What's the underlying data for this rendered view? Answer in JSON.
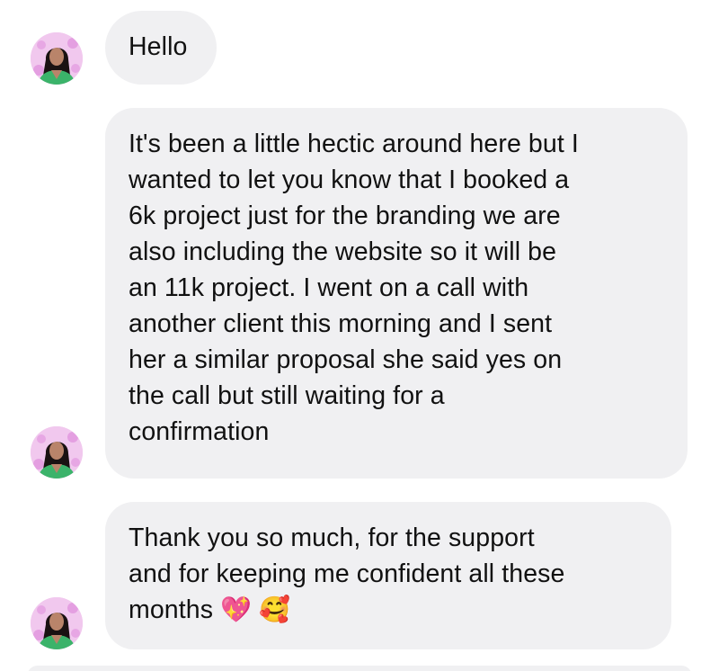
{
  "colors": {
    "bubble_background": "#f0f0f2",
    "text": "#111111",
    "avatar_background": "#f1c8ee",
    "page_background": "#ffffff"
  },
  "messages": [
    {
      "sender_avatar_icon": "profile-avatar",
      "text": "Hello"
    },
    {
      "sender_avatar_icon": "profile-avatar",
      "text": "It's been a little hectic around here but I\nwanted to let you know that I booked a\n6k project just for the branding we are\nalso including the website so it will be\nan 11k project. I went on a call with\nanother client this morning and I sent\nher a similar proposal she said yes on\nthe call but still waiting for a\nconfirmation"
    },
    {
      "sender_avatar_icon": "profile-avatar",
      "text": "Thank you so much, for the support\nand for keeping me confident all these\nmonths",
      "emojis": [
        "💖",
        "🥰"
      ]
    }
  ]
}
